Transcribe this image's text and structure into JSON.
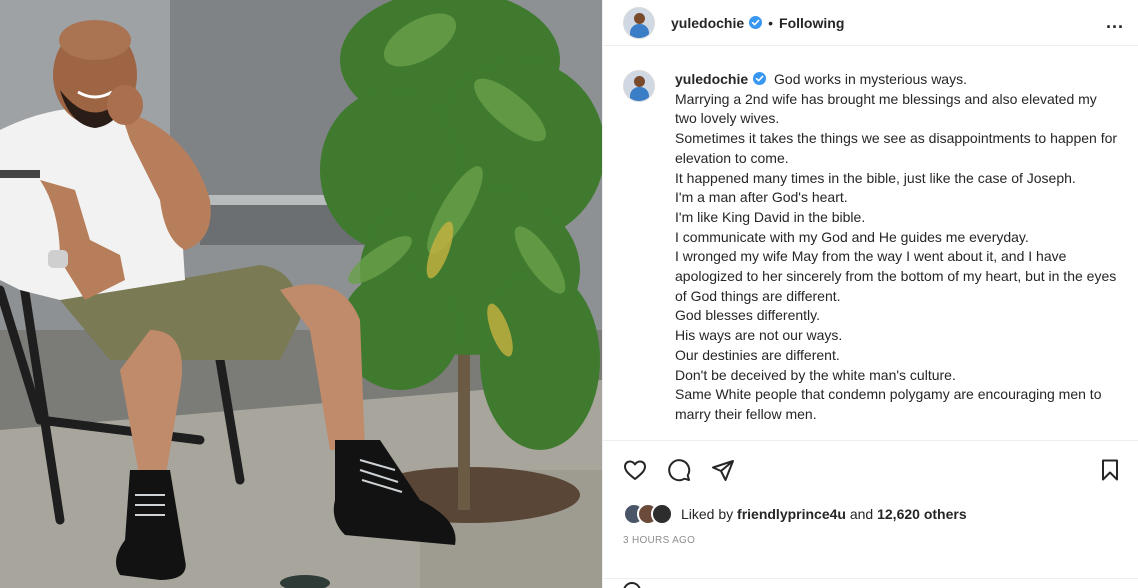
{
  "post": {
    "username": "yuledochie",
    "follow_status": "Following",
    "separator": "•",
    "more_label": "..."
  },
  "caption": {
    "username": "yuledochie",
    "lines": [
      "God works in mysterious ways.",
      "Marrying a 2nd wife has brought me blessings and also elevated my two lovely wives.",
      "Sometimes it takes the things we see as disappointments to happen for elevation to come.",
      "It happened many times in the bible, just like the case of Joseph.",
      "I'm a man after God's heart.",
      "I'm like King David in the bible.",
      "I communicate with my God and He guides me everyday.",
      "I wronged my wife May from the way I went about it, and I have apologized to her sincerely from the bottom of my heart, but in the eyes of God things are different.",
      "God blesses differently.",
      "His ways are not our ways.",
      "Our destinies are different.",
      "Don't be deceived by the white man's culture.",
      "Same White people that condemn polygamy are encouraging men to marry their fellow men."
    ]
  },
  "actions": {
    "like_icon": "heart-icon",
    "comment_icon": "comment-icon",
    "share_icon": "share-icon",
    "save_icon": "bookmark-icon"
  },
  "likes": {
    "prefix": "Liked by",
    "user": "friendlyprince4u",
    "conjunction": "and",
    "others": "12,620 others"
  },
  "timestamp": "3 HOURS AGO",
  "colors": {
    "text": "#262626",
    "muted": "#8e8e8e",
    "verified": "#3897f0",
    "border": "#efefef"
  }
}
